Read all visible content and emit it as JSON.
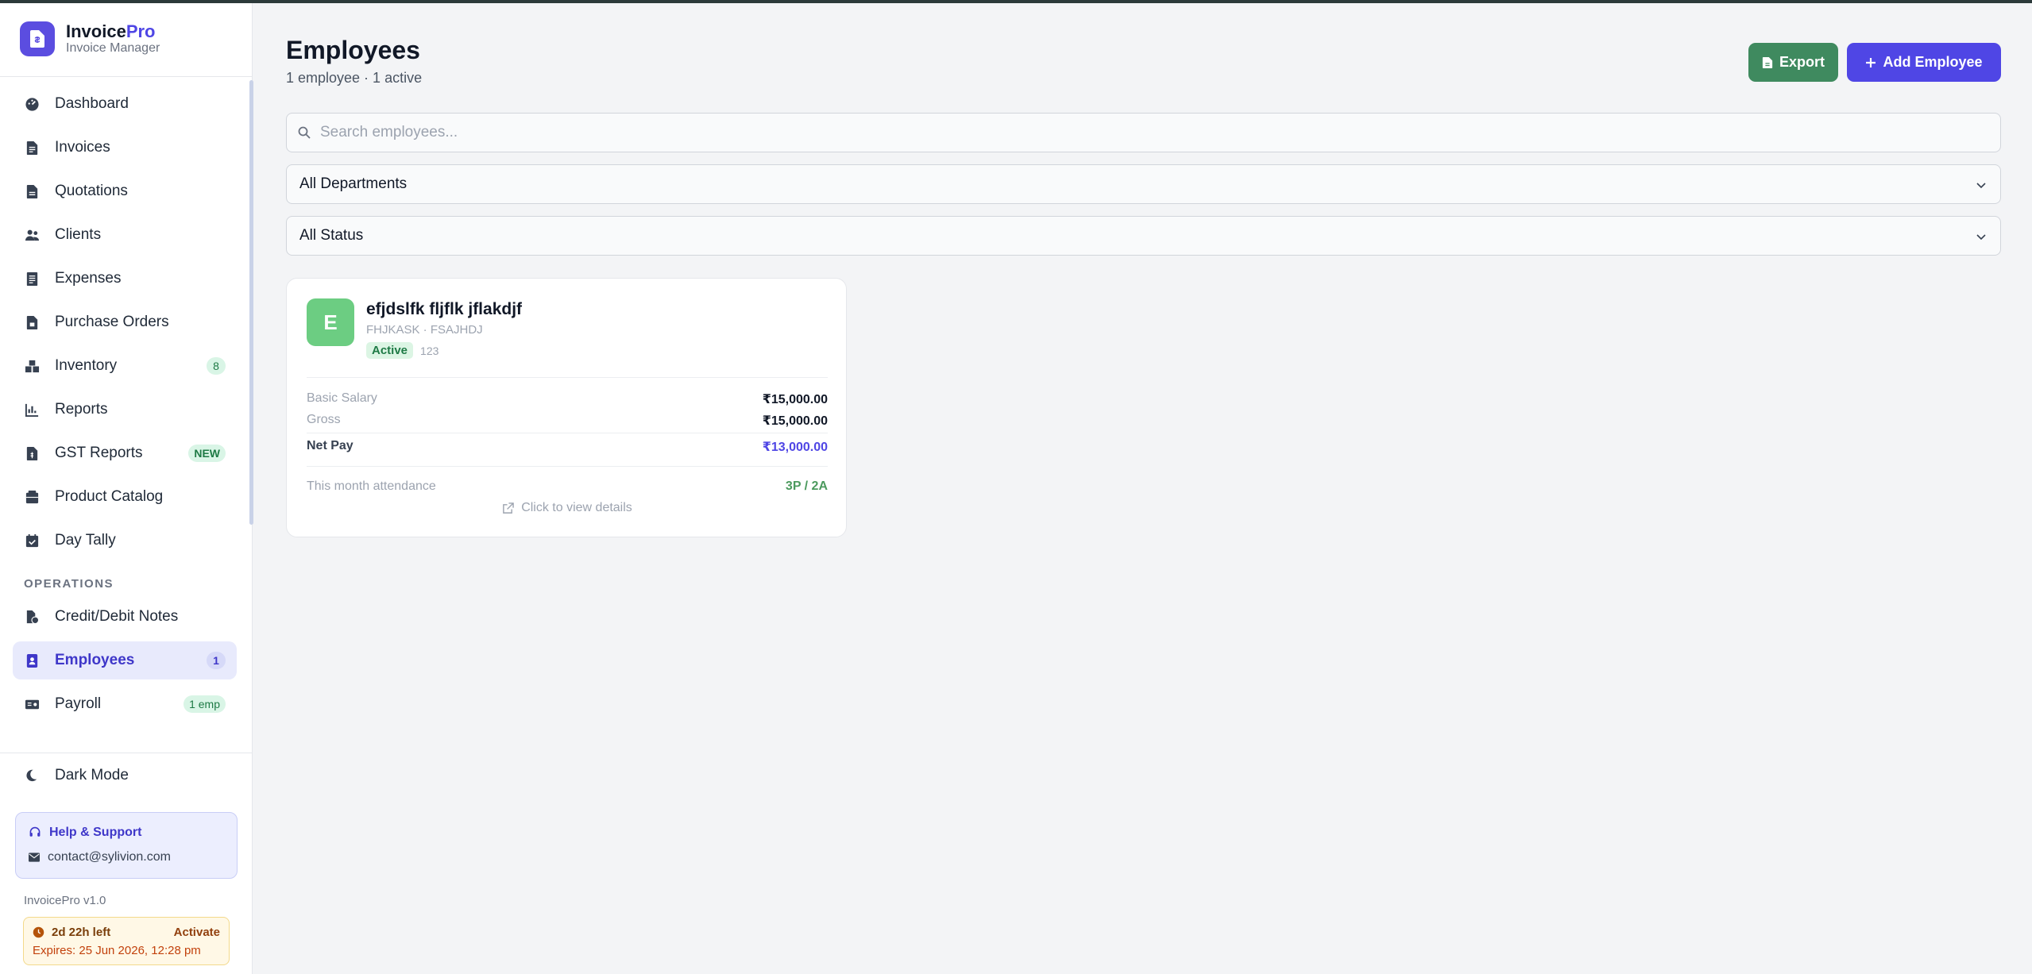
{
  "app": {
    "name": "Invoice",
    "name_accent": "Pro",
    "subtitle": "Invoice Manager"
  },
  "sidebar": {
    "items": [
      {
        "label": "Dashboard",
        "icon": "dashboard-icon"
      },
      {
        "label": "Invoices",
        "icon": "invoice-icon"
      },
      {
        "label": "Quotations",
        "icon": "quotation-icon"
      },
      {
        "label": "Clients",
        "icon": "users-icon"
      },
      {
        "label": "Expenses",
        "icon": "receipt-icon"
      },
      {
        "label": "Purchase Orders",
        "icon": "purchase-order-icon"
      },
      {
        "label": "Inventory",
        "icon": "boxes-icon",
        "badge": "8"
      },
      {
        "label": "Reports",
        "icon": "chart-icon"
      },
      {
        "label": "GST Reports",
        "icon": "gst-file-icon",
        "badge": "NEW"
      },
      {
        "label": "Product Catalog",
        "icon": "catalog-icon"
      },
      {
        "label": "Day Tally",
        "icon": "calendar-icon"
      }
    ],
    "section_operations": "OPERATIONS",
    "operations": [
      {
        "label": "Credit/Debit Notes",
        "icon": "notes-icon"
      },
      {
        "label": "Employees",
        "icon": "id-badge-icon",
        "badge": "1",
        "active": true
      },
      {
        "label": "Payroll",
        "icon": "money-icon",
        "badge": "1 emp"
      }
    ],
    "dark_mode": "Dark Mode",
    "help": {
      "title": "Help & Support",
      "email": "contact@sylivion.com"
    },
    "version": "InvoicePro v1.0",
    "trial": {
      "left": "2d 22h left",
      "activate": "Activate",
      "expires": "Expires: 25 Jun 2026, 12:28 pm"
    }
  },
  "header": {
    "title": "Employees",
    "subtitle": "1 employee · 1 active",
    "export_label": "Export",
    "add_label": "Add Employee"
  },
  "filters": {
    "search_placeholder": "Search employees...",
    "department": "All Departments",
    "status": "All Status"
  },
  "employee": {
    "initial": "E",
    "name": "efjdslfk fljflk jflakdjf",
    "meta": "FHJKASK · FSAJHDJ",
    "status": "Active",
    "code": "123",
    "basic_salary_label": "Basic Salary",
    "basic_salary": "₹15,000.00",
    "gross_label": "Gross",
    "gross": "₹15,000.00",
    "net_pay_label": "Net Pay",
    "net_pay": "₹13,000.00",
    "attendance_label": "This month attendance",
    "attendance": "3P / 2A",
    "view_details": "Click to view details"
  },
  "colors": {
    "accent": "#4f46e5",
    "export": "#3f8a5f",
    "avatar": "#6ccd82",
    "active_nav_bg": "#e8eafc"
  }
}
